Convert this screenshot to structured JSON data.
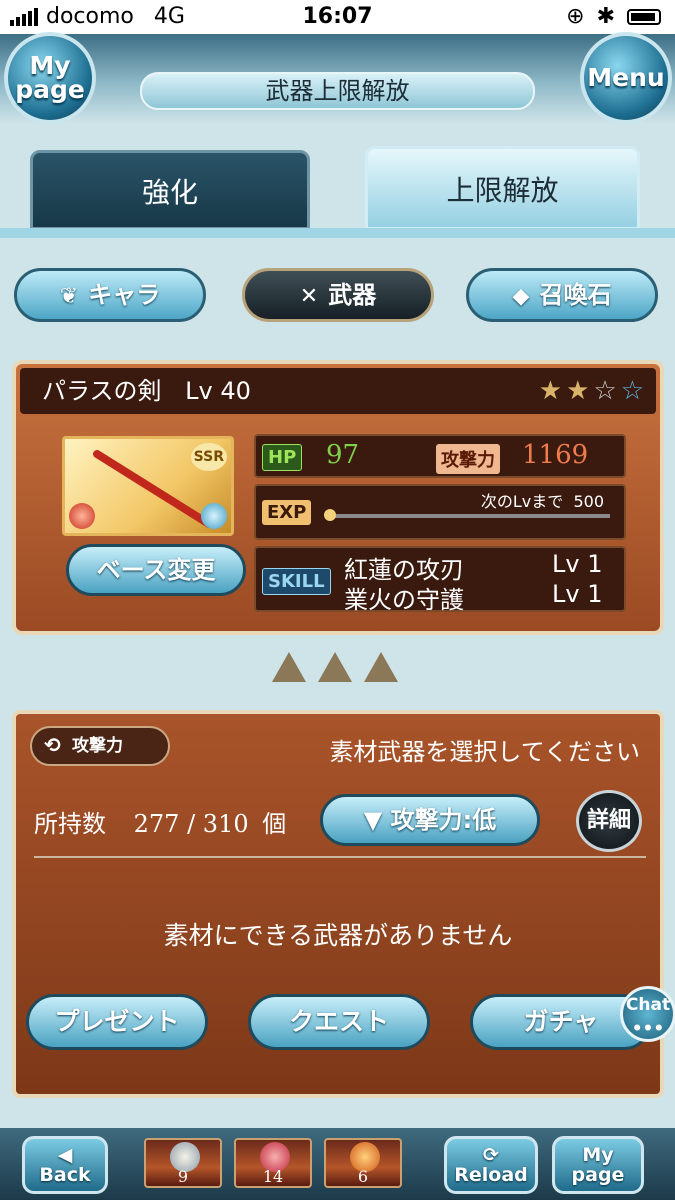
{
  "status_bar": {
    "carrier": "docomo",
    "network": "4G",
    "time": "16:07"
  },
  "header": {
    "title": "武器上限解放",
    "mypage_label": "My page",
    "menu_label": "Menu"
  },
  "tabs": [
    {
      "label": "強化",
      "active": false
    },
    {
      "label": "上限解放",
      "active": true
    }
  ],
  "categories": [
    {
      "label": "キャラ",
      "icon": "character-icon",
      "selected": false
    },
    {
      "label": "武器",
      "icon": "swords-icon",
      "selected": true
    },
    {
      "label": "召喚石",
      "icon": "crystal-icon",
      "selected": false
    }
  ],
  "weapon": {
    "name": "パラスの剣",
    "level": "Lv 40",
    "rarity": "SSR",
    "stars_filled": 2,
    "stars_total": 4,
    "hp_label": "HP",
    "hp": "97",
    "atk_label": "攻撃力",
    "atk": "1169",
    "exp_label": "EXP",
    "exp_next_label": "次のLvまで",
    "exp_next": "500",
    "skill_label": "SKILL",
    "skills": [
      {
        "name": "紅蓮の攻刃",
        "level": "Lv 1"
      },
      {
        "name": "業火の守護",
        "level": "Lv 1"
      }
    ],
    "base_change_label": "ベース変更"
  },
  "material": {
    "filter_label": "攻撃力",
    "title": "素材武器を選択してください",
    "owned_label": "所持数",
    "owned": "277 / 310",
    "owned_unit": "個",
    "sort_label": "▼ 攻撃力:低",
    "detail_label": "詳細",
    "empty_message": "素材にできる武器がありません",
    "buttons": [
      "プレゼント",
      "クエスト",
      "ガチャ"
    ]
  },
  "chat_label": "Chat",
  "footer": {
    "back_label": "Back",
    "reload_label": "Reload",
    "mypage_label": "My page",
    "party": [
      {
        "count": "9"
      },
      {
        "count": "14"
      },
      {
        "count": "6"
      }
    ]
  },
  "colors": {
    "hp": "#7fd14a",
    "atk": "#f07b4c",
    "accent": "#4aa2c2"
  }
}
